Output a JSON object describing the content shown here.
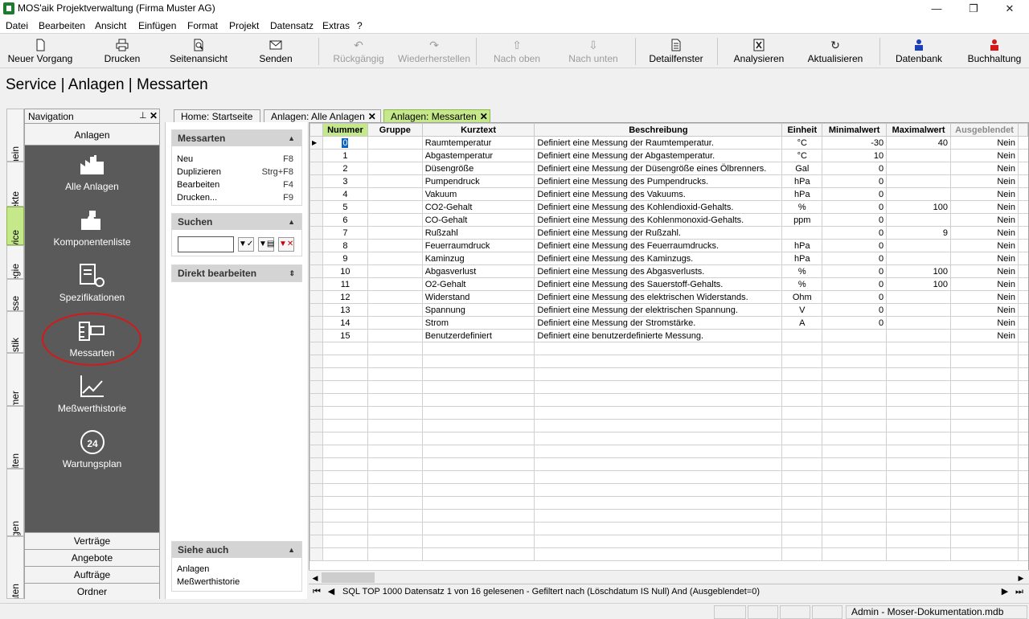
{
  "window": {
    "title": "MOS'aik Projektverwaltung (Firma Muster AG)",
    "minimize": "—",
    "restore": "❐",
    "close": "✕"
  },
  "menu": [
    "Datei",
    "Bearbeiten",
    "Ansicht",
    "Einfügen",
    "Format",
    "Projekt",
    "Datensatz",
    "Extras",
    "?"
  ],
  "toolbar": {
    "neuer_vorgang": "Neuer Vorgang",
    "drucken": "Drucken",
    "seitenansicht": "Seitenansicht",
    "senden": "Senden",
    "rueckgaengig": "Rückgängig",
    "wiederherstellen": "Wiederherstellen",
    "nach_oben": "Nach oben",
    "nach_unten": "Nach unten",
    "detailfenster": "Detailfenster",
    "analysieren": "Analysieren",
    "aktualisieren": "Aktualisieren",
    "datenbank": "Datenbank",
    "buchhaltung": "Buchhaltung"
  },
  "page_title": "Service | Anlagen | Messarten",
  "vertical_tabs": [
    "Allgemein",
    "Projekte",
    "Service",
    "Regie",
    "Kasse",
    "Logistik",
    "Unternehmer",
    "Büroarbeiten",
    "Auswertungen",
    "Stammdaten"
  ],
  "navigation": {
    "header": "Navigation",
    "pin": "⊥",
    "close": "✕",
    "group": "Anlagen",
    "items": [
      "Alle Anlagen",
      "Komponentenliste",
      "Spezifikationen",
      "Messarten",
      "Meßwerthistorie",
      "Wartungsplan"
    ],
    "bottom": [
      "Verträge",
      "Angebote",
      "Aufträge",
      "Ordner"
    ]
  },
  "doc_tabs": [
    "Home: Startseite",
    "Anlagen: Alle Anlagen",
    "Anlagen: Messarten"
  ],
  "taskpane": {
    "messarten": {
      "title": "Messarten",
      "items": [
        {
          "label": "Neu",
          "key": "F8"
        },
        {
          "label": "Duplizieren",
          "key": "Strg+F8"
        },
        {
          "label": "Bearbeiten",
          "key": "F4"
        },
        {
          "label": "Drucken...",
          "key": "F9"
        }
      ]
    },
    "suchen": {
      "title": "Suchen",
      "value": ""
    },
    "direkt": {
      "title": "Direkt bearbeiten"
    },
    "siehe_auch": {
      "title": "Siehe auch",
      "items": [
        "Anlagen",
        "Meßwerthistorie"
      ]
    }
  },
  "grid": {
    "columns": [
      "Nummer",
      "Gruppe",
      "Kurztext",
      "Beschreibung",
      "Einheit",
      "Minimalwert",
      "Maximalwert",
      "Ausgeblendet"
    ],
    "rows": [
      [
        "0",
        "",
        "Raumtemperatur",
        "Definiert eine Messung der Raumtemperatur.",
        "°C",
        "-30",
        "40",
        "Nein"
      ],
      [
        "1",
        "",
        "Abgastemperatur",
        "Definiert eine Messung der Abgastemperatur.",
        "°C",
        "10",
        "",
        "Nein"
      ],
      [
        "2",
        "",
        "Düsengröße",
        "Definiert eine Messung der Düsengröße eines Ölbrenners.",
        "Gal",
        "0",
        "",
        "Nein"
      ],
      [
        "3",
        "",
        "Pumpendruck",
        "Definiert eine Messung des Pumpendrucks.",
        "hPa",
        "0",
        "",
        "Nein"
      ],
      [
        "4",
        "",
        "Vakuum",
        "Definiert eine Messung des Vakuums.",
        "hPa",
        "0",
        "",
        "Nein"
      ],
      [
        "5",
        "",
        "CO2-Gehalt",
        "Definiert eine Messung des Kohlendioxid-Gehalts.",
        "%",
        "0",
        "100",
        "Nein"
      ],
      [
        "6",
        "",
        "CO-Gehalt",
        "Definiert eine Messung des Kohlenmonoxid-Gehalts.",
        "ppm",
        "0",
        "",
        "Nein"
      ],
      [
        "7",
        "",
        "Rußzahl",
        "Definiert eine Messung der Rußzahl.",
        "",
        "0",
        "9",
        "Nein"
      ],
      [
        "8",
        "",
        "Feuerraumdruck",
        "Definiert eine Messung des Feuerraumdrucks.",
        "hPa",
        "0",
        "",
        "Nein"
      ],
      [
        "9",
        "",
        "Kaminzug",
        "Definiert eine Messung des Kaminzugs.",
        "hPa",
        "0",
        "",
        "Nein"
      ],
      [
        "10",
        "",
        "Abgasverlust",
        "Definiert eine Messung des Abgasverlusts.",
        "%",
        "0",
        "100",
        "Nein"
      ],
      [
        "11",
        "",
        "O2-Gehalt",
        "Definiert eine Messung des Sauerstoff-Gehalts.",
        "%",
        "0",
        "100",
        "Nein"
      ],
      [
        "12",
        "",
        "Widerstand",
        "Definiert eine Messung des elektrischen Widerstands.",
        "Ohm",
        "0",
        "",
        "Nein"
      ],
      [
        "13",
        "",
        "Spannung",
        "Definiert eine Messung der elektrischen Spannung.",
        "V",
        "0",
        "",
        "Nein"
      ],
      [
        "14",
        "",
        "Strom",
        "Definiert eine Messung der Stromstärke.",
        "A",
        "0",
        "",
        "Nein"
      ],
      [
        "15",
        "",
        "Benutzerdefiniert",
        "Definiert eine benutzerdefinierte Messung.",
        "",
        "",
        "",
        "Nein"
      ]
    ],
    "status": "SQL TOP 1000 Datensatz 1 von 16 gelesenen - Gefiltert nach (Löschdatum IS Null) And (Ausgeblendet=0)"
  },
  "statusbar": {
    "db": "Admin - Moser-Dokumentation.mdb"
  },
  "colors": {
    "accent_green": "#c4e88a",
    "nav_dark": "#5a5a5a",
    "highlight_red": "#d21a1a",
    "selection_blue": "#0a64c8"
  }
}
